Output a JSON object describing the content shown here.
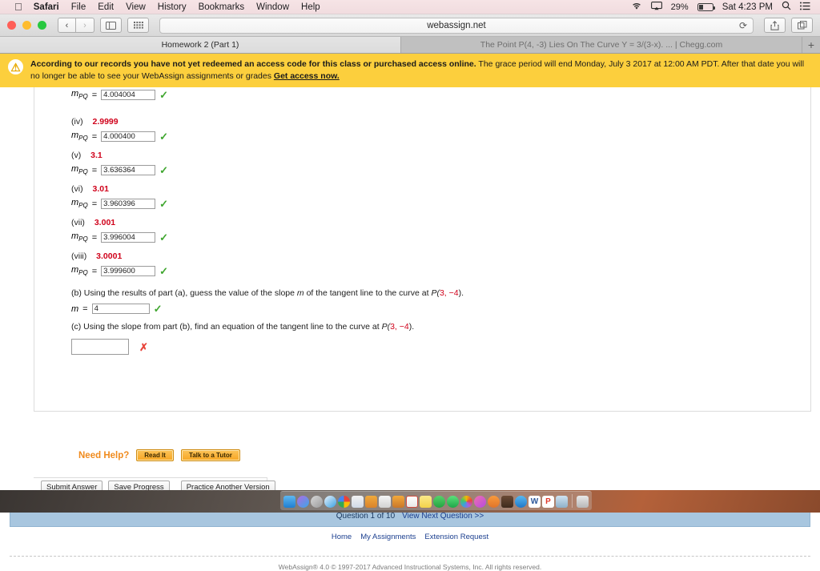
{
  "menubar": {
    "apple": "apple-logo",
    "items": [
      "Safari",
      "File",
      "Edit",
      "View",
      "History",
      "Bookmarks",
      "Window",
      "Help"
    ],
    "status": {
      "wifi": "wifi-icon",
      "airplay": "airplay-icon",
      "battery_percent": "29%",
      "clock": "Sat 4:23 PM",
      "search": "spotlight-icon",
      "notifications": "notification-center-icon"
    }
  },
  "browser": {
    "back": "‹",
    "forward": "›",
    "sidebar": "sidebar-icon",
    "favorites": "favorites-grid-icon",
    "url": "webassign.net",
    "reload": "⟳",
    "share": "share-icon",
    "tabs_overview": "tabs-overview-icon",
    "new_tab": "+",
    "tabs": [
      {
        "label": "Homework 2 (Part 1)",
        "active": true
      },
      {
        "label": "The Point P(4, -3) Lies On The Curve Y = 3/(3-x). ... | Chegg.com",
        "active": false
      }
    ]
  },
  "alert": {
    "icon": "warning-icon",
    "bold_lead": "According to our records you have not yet redeemed an access code for this class or purchased access online.",
    "rest": " The grace period will end Monday, July 3 2017 at 12:00 AM PDT. After that date you will no longer be able to see your WebAssign assignments or grades ",
    "link": "Get access now."
  },
  "question": {
    "rows": [
      {
        "roman": "",
        "x": "",
        "label": "m",
        "sub": "PQ",
        "eq": "=",
        "value": "4.004004",
        "mark": "check"
      },
      {
        "roman": "(iv)",
        "x": "2.9999",
        "label": "m",
        "sub": "PQ",
        "eq": "=",
        "value": "4.000400",
        "mark": "check"
      },
      {
        "roman": "(v)",
        "x": "3.1",
        "label": "m",
        "sub": "PQ",
        "eq": "=",
        "value": "3.636364",
        "mark": "check"
      },
      {
        "roman": "(vi)",
        "x": "3.01",
        "label": "m",
        "sub": "PQ",
        "eq": "=",
        "value": "3.960396",
        "mark": "check"
      },
      {
        "roman": "(vii)",
        "x": "3.001",
        "label": "m",
        "sub": "PQ",
        "eq": "=",
        "value": "3.996004",
        "mark": "check"
      },
      {
        "roman": "(viii)",
        "x": "3.0001",
        "label": "m",
        "sub": "PQ",
        "eq": "=",
        "value": "3.999600",
        "mark": "check"
      }
    ],
    "part_b": {
      "text_1": "(b) Using the results of part (a), guess the value of the slope ",
      "text_m": "m",
      "text_2": " of the tangent line to the curve at  ",
      "point_p": "P(",
      "point_red": "3, −4",
      "point_close": ").",
      "m_label": "m",
      "m_eq": "=",
      "m_value": "4",
      "mark": "check"
    },
    "part_c": {
      "text_1": "(c) Using the slope from part (b), find an equation of the tangent line to the curve at  ",
      "point_p": "P(",
      "point_red": "3, −4",
      "point_close": ").",
      "value": "",
      "mark": "cross"
    }
  },
  "help": {
    "title": "Need Help?",
    "read_it": "Read It",
    "tutor": "Talk to a Tutor"
  },
  "actions": {
    "submit": "Submit Answer",
    "save": "Save Progress",
    "practice": "Practice Another Version"
  },
  "navbar": {
    "counter": "Question 1 of 10",
    "next": "View Next Question >>"
  },
  "footer": {
    "links": [
      "Home",
      "My Assignments",
      "Extension Request"
    ],
    "copyright": "WebAssign® 4.0 © 1997-2017 Advanced Instructional Systems, Inc. All rights reserved."
  },
  "dock": {
    "icons": [
      "finder-icon",
      "siri-icon",
      "launchpad-icon",
      "safari-icon",
      "chrome-icon",
      "preview-icon",
      "contacts-icon",
      "notes-icon",
      "pages-icon",
      "calendar-icon",
      "stickies-icon",
      "messages-icon",
      "facetime-icon",
      "photos-icon",
      "itunes-icon",
      "books-icon",
      "imovie-icon",
      "appstore-icon",
      "word-icon",
      "pdf-icon",
      "utility-icon"
    ],
    "trash": "trash-icon"
  },
  "colors": {
    "alert_bg": "#fccf3d",
    "accent_red": "#d0021b",
    "check_green": "#3fa62f",
    "cross_red": "#e8443a",
    "help_orange": "#f08b1d",
    "nav_blue": "#a8c6df",
    "link_blue": "#1b3f8f"
  }
}
